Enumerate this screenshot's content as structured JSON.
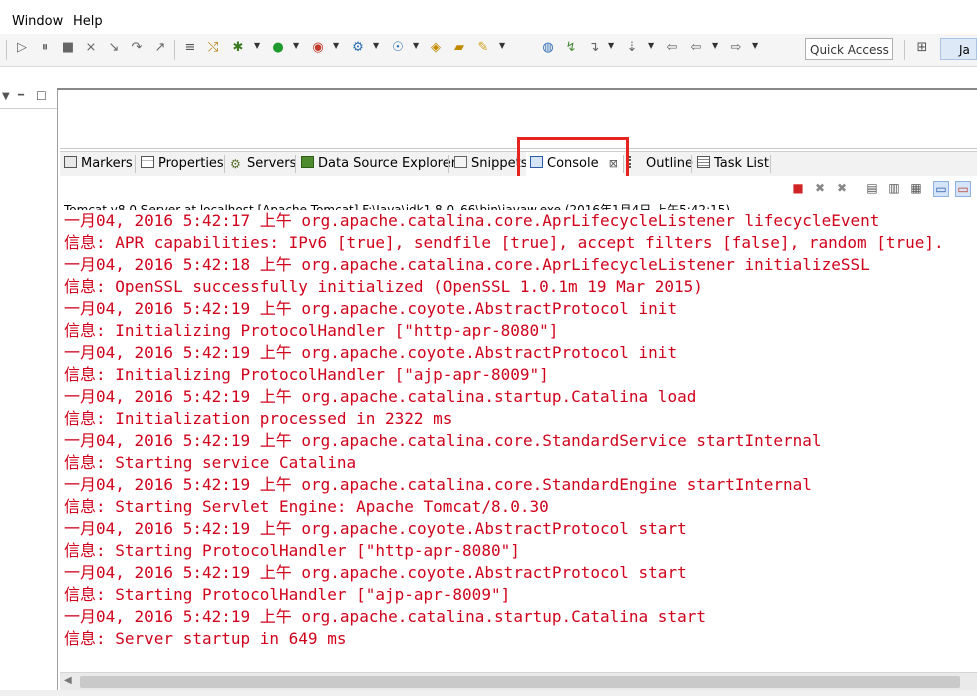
{
  "menu": {
    "items": [
      "Window",
      "Help"
    ]
  },
  "toolbar": {
    "quick_access": "Quick Access",
    "perspective_label": "Ja"
  },
  "tabs": [
    {
      "label": "Markers",
      "icon": "markers-icon"
    },
    {
      "label": "Properties",
      "icon": "properties-icon"
    },
    {
      "label": "Servers",
      "icon": "servers-icon"
    },
    {
      "label": "Data Source Explorer",
      "icon": "data-source-icon"
    },
    {
      "label": "Snippets",
      "icon": "snippets-icon"
    },
    {
      "label": "Console",
      "icon": "console-icon",
      "active": true
    },
    {
      "label": "Outline",
      "icon": "outline-icon"
    },
    {
      "label": "Task List",
      "icon": "task-list-icon"
    }
  ],
  "console": {
    "description": "Tomcat v8.0 Server at localhost [Apache Tomcat] F:\\Java\\jdk1.8.0_66\\bin\\javaw.exe (2016年1月4日 上午5:42:15)",
    "lines": [
      "一月04, 2016 5:42:17 上午 org.apache.catalina.core.AprLifecycleListener lifecycleEvent",
      "信息: APR capabilities: IPv6 [true], sendfile [true], accept filters [false], random [true].",
      "一月04, 2016 5:42:18 上午 org.apache.catalina.core.AprLifecycleListener initializeSSL",
      "信息: OpenSSL successfully initialized (OpenSSL 1.0.1m 19 Mar 2015)",
      "一月04, 2016 5:42:19 上午 org.apache.coyote.AbstractProtocol init",
      "信息: Initializing ProtocolHandler [\"http-apr-8080\"]",
      "一月04, 2016 5:42:19 上午 org.apache.coyote.AbstractProtocol init",
      "信息: Initializing ProtocolHandler [\"ajp-apr-8009\"]",
      "一月04, 2016 5:42:19 上午 org.apache.catalina.startup.Catalina load",
      "信息: Initialization processed in 2322 ms",
      "一月04, 2016 5:42:19 上午 org.apache.catalina.core.StandardService startInternal",
      "信息: Starting service Catalina",
      "一月04, 2016 5:42:19 上午 org.apache.catalina.core.StandardEngine startInternal",
      "信息: Starting Servlet Engine: Apache Tomcat/8.0.30",
      "一月04, 2016 5:42:19 上午 org.apache.coyote.AbstractProtocol start",
      "信息: Starting ProtocolHandler [\"http-apr-8080\"]",
      "一月04, 2016 5:42:19 上午 org.apache.coyote.AbstractProtocol start",
      "信息: Starting ProtocolHandler [\"ajp-apr-8009\"]",
      "一月04, 2016 5:42:19 上午 org.apache.catalina.startup.Catalina start",
      "信息: Server startup in 649 ms"
    ]
  },
  "colors": {
    "console_text": "#d0021b",
    "highlight_box": "#e52420"
  }
}
